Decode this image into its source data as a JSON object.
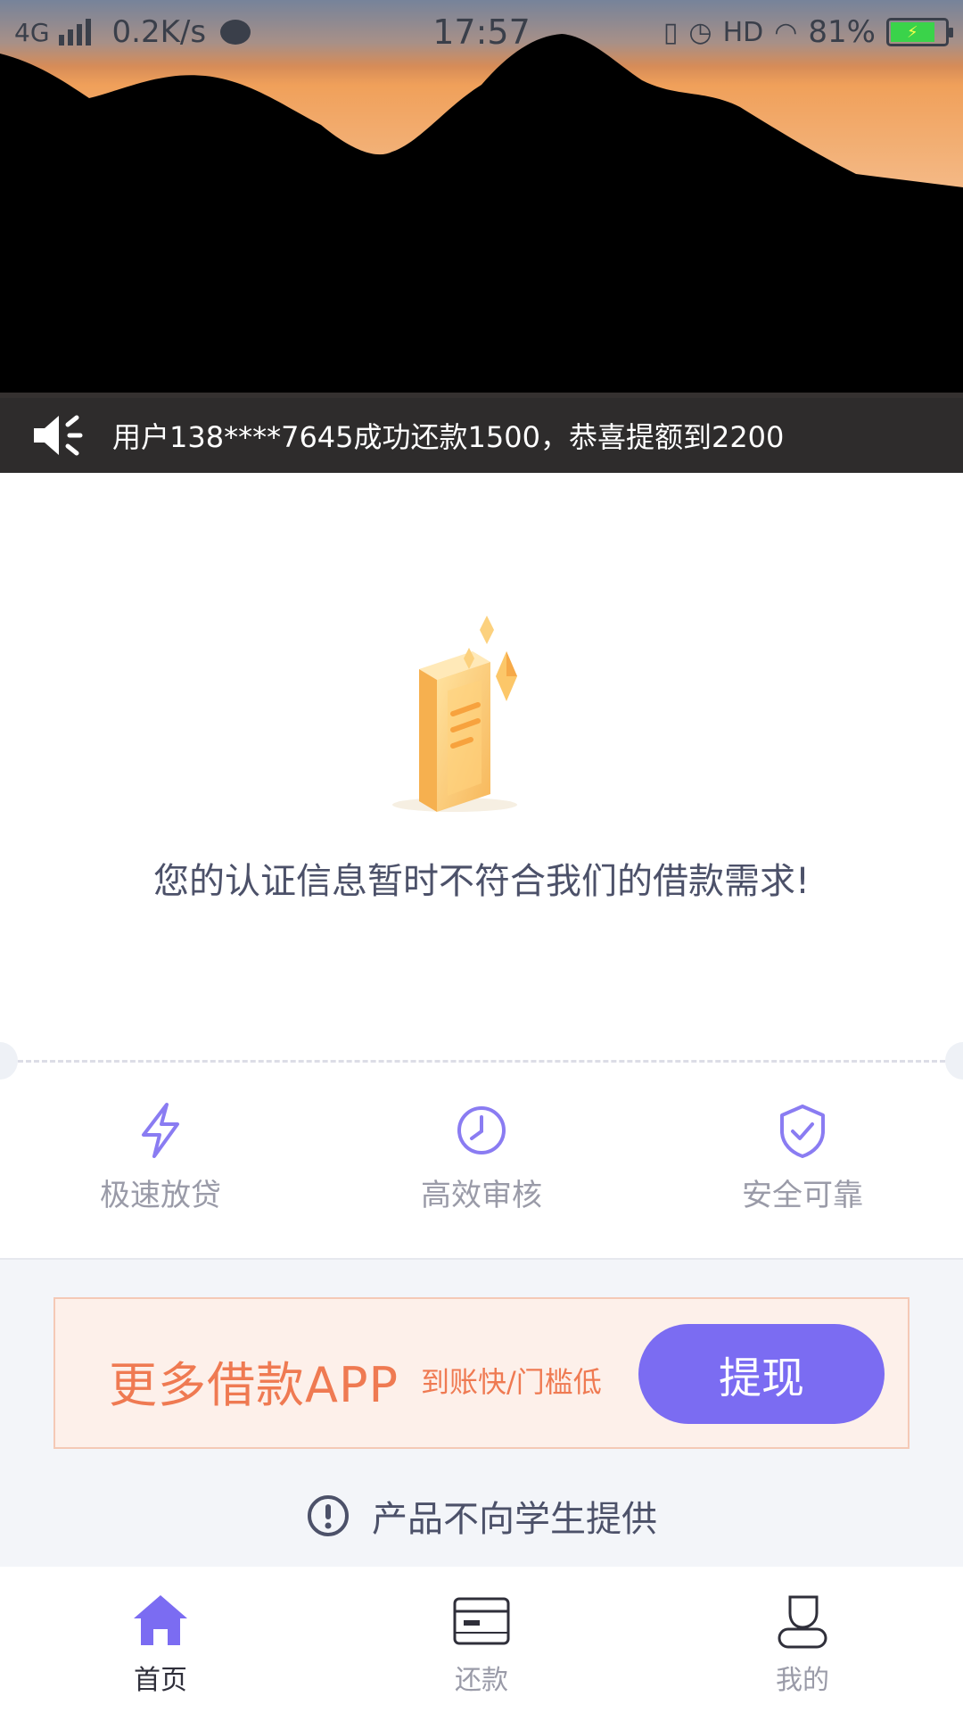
{
  "status_bar": {
    "network": "4G",
    "speed": "0.2K/s",
    "time": "17:57",
    "hd": "HD",
    "battery": "81%"
  },
  "marquee": {
    "text": "用户138****7645成功还款1500，恭喜提额到2200"
  },
  "status": {
    "message": "您的认证信息暂时不符合我们的借款需求!"
  },
  "features": [
    {
      "label": "极速放贷",
      "icon": "lightning-icon"
    },
    {
      "label": "高效审核",
      "icon": "clock-icon"
    },
    {
      "label": "安全可靠",
      "icon": "shield-check-icon"
    }
  ],
  "promo": {
    "title": "更多借款APP",
    "subtitle": "到账快/门槛低",
    "button": "提现"
  },
  "notice": {
    "text": "产品不向学生提供"
  },
  "nav": [
    {
      "label": "首页",
      "icon": "home-icon",
      "active": true
    },
    {
      "label": "还款",
      "icon": "card-icon",
      "active": false
    },
    {
      "label": "我的",
      "icon": "user-icon",
      "active": false
    }
  ],
  "colors": {
    "accent": "#7b6cf2",
    "promo_text": "#ef7a52",
    "promo_bg": "#fdf0ea",
    "muted_text": "#9a9ba8"
  }
}
